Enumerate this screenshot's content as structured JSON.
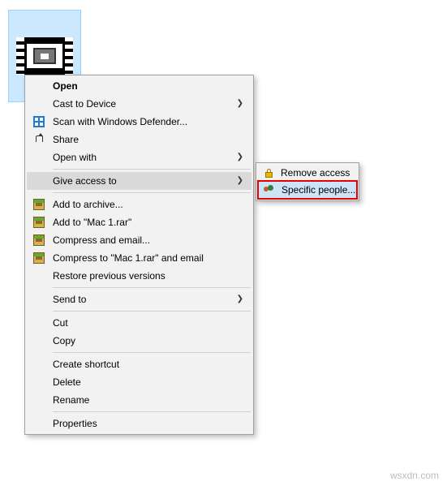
{
  "file": {
    "selected": true
  },
  "menu": {
    "open": "Open",
    "cast": "Cast to Device",
    "defender": "Scan with Windows Defender...",
    "share": "Share",
    "openwith": "Open with",
    "giveaccess": "Give access to",
    "archive_add": "Add to archive...",
    "archive_addnamed": "Add to \"Mac 1.rar\"",
    "archive_email": "Compress and email...",
    "archive_named_email": "Compress to \"Mac 1.rar\" and email",
    "restore": "Restore previous versions",
    "sendto": "Send to",
    "cut": "Cut",
    "copy": "Copy",
    "shortcut": "Create shortcut",
    "delete": "Delete",
    "rename": "Rename",
    "properties": "Properties"
  },
  "submenu": {
    "remove": "Remove access",
    "specific": "Specific people..."
  },
  "watermark": "wsxdn.com"
}
